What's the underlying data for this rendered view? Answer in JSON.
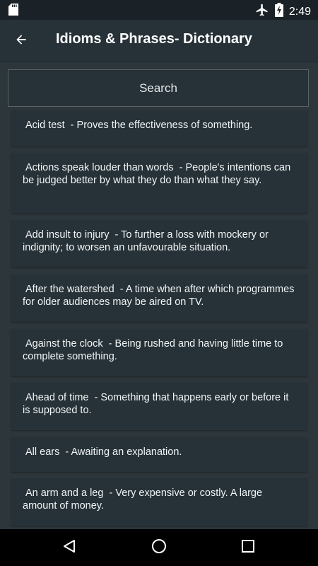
{
  "status_bar": {
    "time": "2:49",
    "icons": [
      "sd-card-icon",
      "airplane-mode-icon",
      "battery-charging-icon"
    ]
  },
  "app_bar": {
    "title": "Idioms & Phrases- Dictionary",
    "back_icon": "arrow-back-icon"
  },
  "search": {
    "placeholder": "Search"
  },
  "idioms": [
    {
      "term": "Acid test",
      "definition": "Proves the effectiveness of something."
    },
    {
      "term": "Actions speak louder than words",
      "definition": "People's intentions can be judged better by what they do than what they say."
    },
    {
      "term": "Add insult to injury",
      "definition": "To further a loss with mockery or indignity; to worsen an unfavourable situation."
    },
    {
      "term": "After the watershed",
      "definition": "A time when after which programmes for older audiences may be aired on TV."
    },
    {
      "term": "Against the clock",
      "definition": "Being rushed and having little time to complete something."
    },
    {
      "term": "Ahead of time",
      "definition": "Something that happens early or before it is supposed to."
    },
    {
      "term": "All ears",
      "definition": "Awaiting an explanation."
    },
    {
      "term": "An arm and a leg",
      "definition": "Very expensive or costly. A large amount of money."
    }
  ],
  "nav_bar": {
    "icons": [
      "back-triangle-icon",
      "home-circle-icon",
      "recents-square-icon"
    ]
  },
  "colors": {
    "app_bar": "#263238",
    "list_background": "#2d363b",
    "card": "#263238",
    "text": "#ffffff"
  }
}
